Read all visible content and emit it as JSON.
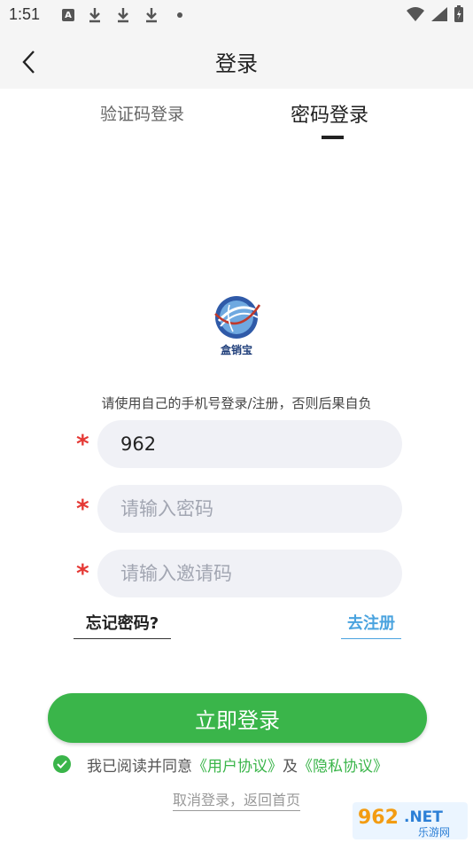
{
  "status_bar": {
    "time": "1:51",
    "icons": [
      "a-notification-icon",
      "download-icon",
      "download-icon",
      "download-icon",
      "dot-icon",
      "wifi-icon",
      "signal-icon",
      "battery-icon"
    ]
  },
  "nav": {
    "title": "登录"
  },
  "tabs": {
    "code_login": "验证码登录",
    "password_login": "密码登录",
    "active": "password_login"
  },
  "logo": {
    "text": "盒销宝"
  },
  "notice": "请使用自己的手机号登录/注册，否则后果自负",
  "form": {
    "required_mark": "*",
    "phone": {
      "value": "962",
      "placeholder": ""
    },
    "password": {
      "value": "",
      "placeholder": "请输入密码"
    },
    "invite": {
      "value": "",
      "placeholder": "请输入邀请码"
    }
  },
  "links": {
    "forgot": "忘记密码?",
    "register": "去注册"
  },
  "login_button": "立即登录",
  "agreement": {
    "prefix": "我已阅读并同意",
    "user_agreement": "《用户协议》",
    "and": "及",
    "privacy_agreement": "《隐私协议》"
  },
  "cancel": "取消登录，返回首页",
  "watermark": {
    "number": "962",
    "suffix": ".NET",
    "text": "乐游网"
  },
  "colors": {
    "accent_green": "#3ab54a",
    "link_blue": "#4aa3df",
    "required_red": "#e53935",
    "input_bg": "#f0f1f6"
  }
}
